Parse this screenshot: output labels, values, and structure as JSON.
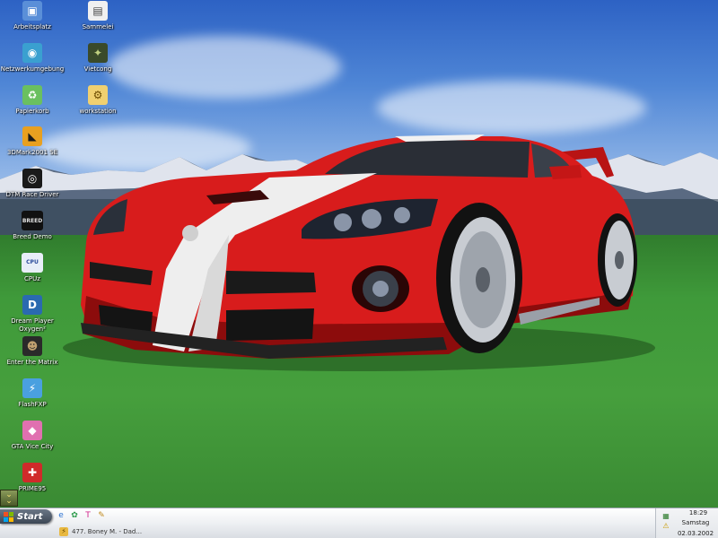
{
  "desktop": {
    "icons": [
      {
        "label": "Arbeitsplatz",
        "icon": "computer-icon",
        "glyph": "▣",
        "color": "#5a8fd8",
        "fg": "#ffffff"
      },
      {
        "label": "Netzwerkumgebung",
        "icon": "network-icon",
        "glyph": "◉",
        "color": "#3aa0d0",
        "fg": "#ffffff"
      },
      {
        "label": "Papierkorb",
        "icon": "recycle-bin-icon",
        "glyph": "♻",
        "color": "#6ac060",
        "fg": "#ffffff"
      },
      {
        "label": "3DMark2001 SE",
        "icon": "3dmark-icon",
        "glyph": "◣",
        "color": "#e8a020",
        "fg": "#1a1a1a"
      },
      {
        "label": "DTM Race Driver",
        "icon": "race-driver-icon",
        "glyph": "◎",
        "color": "#1a1a1a",
        "fg": "#ffffff"
      },
      {
        "label": "Breed Demo",
        "icon": "breed-icon",
        "glyph": "BREED",
        "color": "#111111",
        "fg": "#e0e0e0"
      },
      {
        "label": "CPUz",
        "icon": "cpuz-icon",
        "glyph": "CPU",
        "color": "#e8eef8",
        "fg": "#2a4a9a"
      },
      {
        "label": "Dream Player\nOxygen²",
        "icon": "dream-player-icon",
        "glyph": "D",
        "color": "#2a6ab0",
        "fg": "#ffffff"
      },
      {
        "label": "Enter the Matrix",
        "icon": "matrix-icon",
        "glyph": "☻",
        "color": "#2a2a2a",
        "fg": "#c0a070"
      },
      {
        "label": "FlashFXP",
        "icon": "flashfxp-icon",
        "glyph": "⚡",
        "color": "#4aa0e0",
        "fg": "#ffffff"
      },
      {
        "label": "GTA Vice City",
        "icon": "gta-icon",
        "glyph": "◆",
        "color": "#e070b0",
        "fg": "#ffffff"
      },
      {
        "label": "PRIME95",
        "icon": "prime95-icon",
        "glyph": "✚",
        "color": "#d02a2a",
        "fg": "#ffffff"
      }
    ],
    "icons_col2": [
      {
        "label": "Sammelei",
        "icon": "document-icon",
        "glyph": "▤",
        "color": "#f0f0f0",
        "fg": "#444444"
      },
      {
        "label": "Vietcong",
        "icon": "vietcong-icon",
        "glyph": "✦",
        "color": "#3a4a2a",
        "fg": "#c0d080"
      },
      {
        "label": "workstation",
        "icon": "workstation-icon",
        "glyph": "⚙",
        "color": "#f0d070",
        "fg": "#6a4a00"
      }
    ]
  },
  "taskbar": {
    "start_label": "Start",
    "quick_launch": [
      {
        "icon": "ie-icon",
        "glyph": "e",
        "color": "#2a70d0"
      },
      {
        "icon": "app-icon",
        "glyph": "✿",
        "color": "#2a9a4a"
      },
      {
        "icon": "telekom-icon",
        "glyph": "T",
        "color": "#d0208a"
      },
      {
        "icon": "tool-icon",
        "glyph": "✎",
        "color": "#c08a20"
      }
    ],
    "task_item": "477. Boney M. - Dad...",
    "tray": {
      "time": "18:29",
      "day": "Samstag",
      "date": "02.03.2002"
    }
  }
}
